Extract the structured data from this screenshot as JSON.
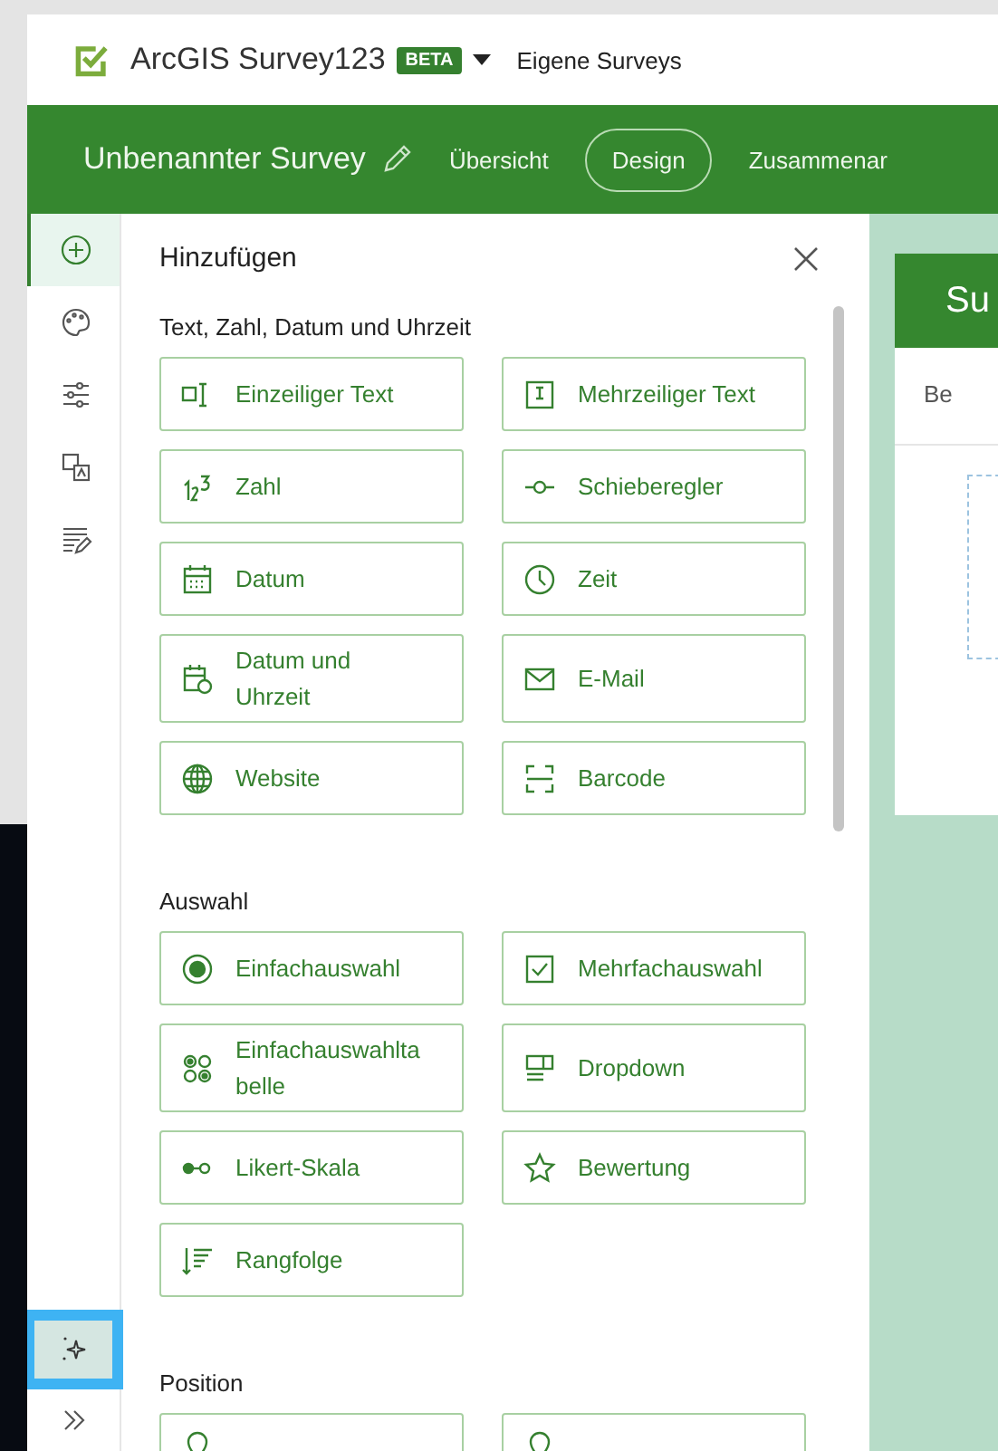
{
  "header": {
    "app_title": "ArcGIS Survey123",
    "badge": "BETA",
    "nav_link": "Eigene Surveys"
  },
  "survey_bar": {
    "title": "Unbenannter Survey",
    "tabs": [
      {
        "label": "Übersicht",
        "selected": false
      },
      {
        "label": "Design",
        "selected": true
      },
      {
        "label": "Zusammenar",
        "selected": false
      }
    ]
  },
  "rail": {
    "items": [
      {
        "selected": true
      },
      {
        "selected": false
      },
      {
        "selected": false
      },
      {
        "selected": false
      },
      {
        "selected": false
      }
    ],
    "assistant_button": {
      "focused": true
    }
  },
  "add_panel": {
    "title": "Hinzufügen",
    "sections": [
      {
        "title": "Text, Zahl, Datum und Uhrzeit",
        "items": [
          "Einzeiliger Text",
          "Mehrzeiliger Text",
          "Zahl",
          "Schieberegler",
          "Datum",
          "Zeit",
          "Datum und Uhrzeit",
          "E-Mail",
          "Website",
          "Barcode"
        ]
      },
      {
        "title": "Auswahl",
        "items": [
          "Einfachauswahl",
          "Mehrfachauswahl",
          "Einfachauswahltabelle",
          "Dropdown",
          "Likert-Skala",
          "Bewertung",
          "Rangfolge"
        ]
      },
      {
        "title": "Position",
        "items": [
          {
            "cut_off": true
          },
          {
            "cut_off": true
          }
        ]
      }
    ]
  },
  "preview": {
    "header": "Su",
    "tab": "Be"
  }
}
